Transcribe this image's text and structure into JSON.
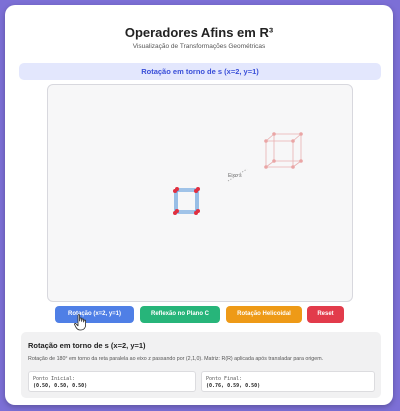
{
  "header": {
    "title": "Operadores Afins em R³",
    "subtitle": "Visualização de Transformações Geométricas"
  },
  "banner": {
    "label": "Rotação em torno de s (x=2, y=1)"
  },
  "viewport": {
    "axis_label": "Eixo s"
  },
  "buttons": [
    {
      "label": "Rotação (x=2, y=1)",
      "color": "#4f7fe6"
    },
    {
      "label": "Reflexão no Plano C",
      "color": "#27b57a"
    },
    {
      "label": "Rotação Helicoidal",
      "color": "#ee9a17"
    },
    {
      "label": "Reset",
      "color": "#e23b4b"
    }
  ],
  "info": {
    "title": "Rotação em torno de s (x=2, y=1)",
    "description": "Rotação de 180° em torno da reta paralela ao eixo z passando por (2,1,0). Matriz: R(R) aplicada após transladar para origem.",
    "initial_label": "Ponto Inicial:",
    "initial_value": "(0.50, 0.50, 0.50)",
    "final_label": "Ponto Final:",
    "final_value": "(0.76, 0.59, 0.50)"
  },
  "colors": {
    "accent": "#3a4fd8",
    "cube_edges": "#4a8fd8",
    "cube_vertices": "#e03040",
    "ghost_cube": "#e8b0b0"
  }
}
